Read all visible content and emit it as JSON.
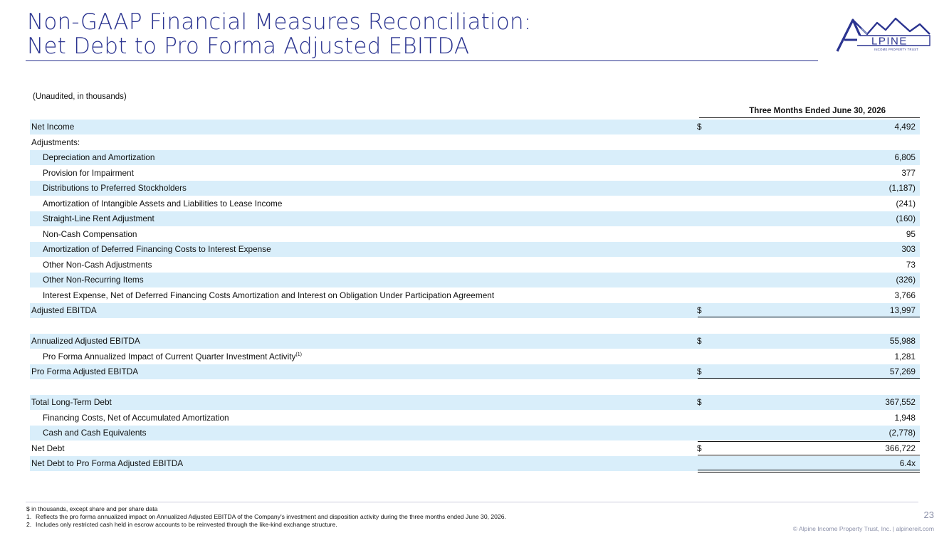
{
  "title": {
    "line1": "Non-GAAP Financial Measures Reconciliation:",
    "line2": "Net Debt to Pro Forma Adjusted EBITDA"
  },
  "logo": {
    "letter": "A",
    "name": "LPINE",
    "tagline": "INCOME PROPERTY TRUST",
    "color": "#2b3490"
  },
  "subtitle": "(Unaudited, in thousands)",
  "column_header": "Three Months Ended June 30, 2026",
  "rows": [
    {
      "label": "Net Income",
      "dollar": "$",
      "value": "4,492"
    },
    {
      "label": "Adjustments:",
      "dollar": "",
      "value": ""
    },
    {
      "label": "Depreciation and Amortization",
      "dollar": "",
      "value": "6,805"
    },
    {
      "label": "Provision for Impairment",
      "dollar": "",
      "value": "377"
    },
    {
      "label": "Distributions to Preferred Stockholders",
      "dollar": "",
      "value": "(1,187)"
    },
    {
      "label": "Amortization of Intangible Assets and Liabilities to Lease Income",
      "dollar": "",
      "value": "(241)"
    },
    {
      "label": "Straight-Line Rent Adjustment",
      "dollar": "",
      "value": "(160)"
    },
    {
      "label": "Non-Cash Compensation",
      "dollar": "",
      "value": "95"
    },
    {
      "label": "Amortization of Deferred Financing Costs to Interest Expense",
      "dollar": "",
      "value": "303"
    },
    {
      "label": "Other Non-Cash Adjustments",
      "dollar": "",
      "value": "73"
    },
    {
      "label": "Other Non-Recurring Items",
      "dollar": "",
      "value": "(326)"
    },
    {
      "label": "Interest Expense, Net of Deferred Financing Costs Amortization and Interest on Obligation Under Participation Agreement",
      "dollar": "",
      "value": "3,766"
    },
    {
      "label": "Adjusted EBITDA",
      "dollar": "$",
      "value": "13,997"
    },
    {
      "label": "Annualized Adjusted EBITDA",
      "dollar": "$",
      "value": "55,988"
    },
    {
      "label": "Pro Forma Annualized Impact of Current Quarter Investment Activity",
      "sup": "(1)",
      "dollar": "",
      "value": "1,281"
    },
    {
      "label": "Pro Forma Adjusted EBITDA",
      "dollar": "$",
      "value": "57,269"
    },
    {
      "label": "Total Long-Term Debt",
      "dollar": "$",
      "value": "367,552"
    },
    {
      "label": "Financing Costs, Net of Accumulated Amortization",
      "dollar": "",
      "value": "1,948"
    },
    {
      "label": "Cash and Cash Equivalents",
      "dollar": "",
      "value": "(2,778)"
    },
    {
      "label": "Net Debt",
      "dollar": "$",
      "value": "366,722"
    },
    {
      "label": "Net Debt to Pro Forma Adjusted EBITDA",
      "dollar": "",
      "value": "6.4x"
    }
  ],
  "footnotes": {
    "note0": "$ in thousands, except share and per share data",
    "note1_num": "1.",
    "note1": "Reflects the pro forma annualized impact on Annualized Adjusted EBITDA of the Company's investment and disposition activity during the three months ended June 30, 2026.",
    "note2_num": "2.",
    "note2": "Includes only restricted cash held in escrow accounts to be reinvested through the like-kind exchange structure."
  },
  "page_number": "23",
  "copyright": "© Alpine Income Property Trust, Inc.  |  alpinereit.com"
}
